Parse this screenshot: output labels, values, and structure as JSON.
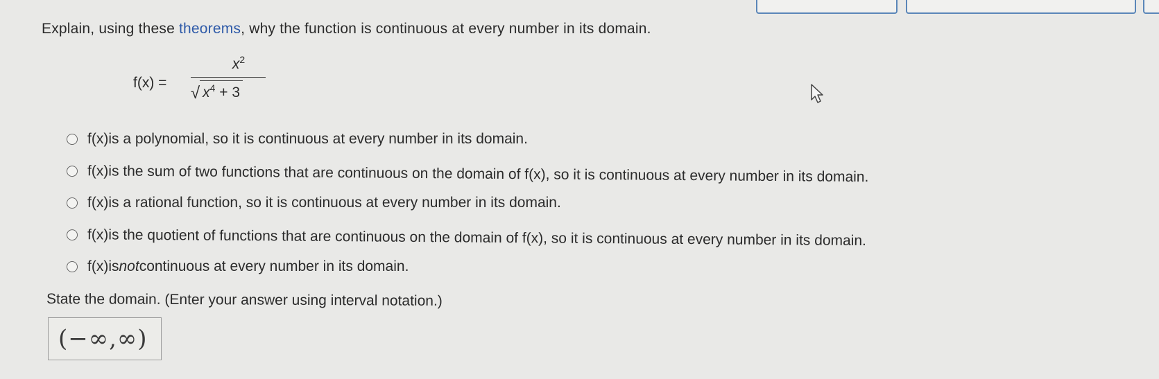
{
  "header_boxes": [
    "",
    "",
    ""
  ],
  "question": {
    "prefix": "Explain, using these ",
    "link_text": "theorems",
    "suffix": ", why the function is continuous at every number in its domain."
  },
  "formula": {
    "lhs": "f(x) =",
    "numerator_base": "x",
    "numerator_exp": "2",
    "radicand_base": "x",
    "radicand_exp": "4",
    "radicand_rest": " + 3"
  },
  "options": [
    {
      "fx": "f(x)",
      "text": " is a polynomial, so it is continuous at every number in its domain."
    },
    {
      "fx": "f(x)",
      "text": " is the sum of two functions that are continuous on the domain of f(x), so it is continuous at every number in its domain."
    },
    {
      "fx": "f(x)",
      "text": " is a rational function, so it is continuous at every number in its domain."
    },
    {
      "fx": "f(x)",
      "text": " is the quotient of functions that are continuous on the domain of f(x), so it is continuous at every number in its domain."
    },
    {
      "fx": "f(x)",
      "text_pre": " is ",
      "text_em": "not",
      "text_post": " continuous at every number in its domain."
    }
  ],
  "domain_prompt": "State the domain. (Enter your answer using interval notation.)",
  "answer_value": "(−∞,∞)",
  "icons": {
    "cursor": "pointer-cursor-icon",
    "radio": "radio-button-icon"
  },
  "colors": {
    "link": "#2e5aa8",
    "box_border": "#5a86b8",
    "background": "#e9e9e7"
  }
}
